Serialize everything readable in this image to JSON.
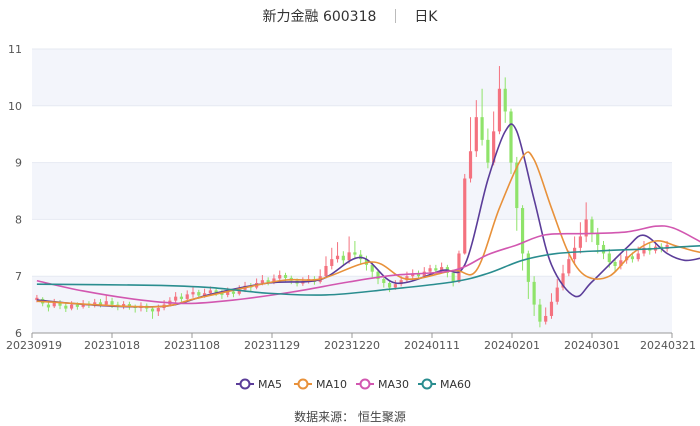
{
  "header": {
    "name": "新力金融",
    "code": "600318",
    "period": "日K"
  },
  "source": "数据来源： 恒生聚源",
  "colors": {
    "up": "#f4727f",
    "down": "#8fe36a",
    "ma5": "#5b3d99",
    "ma10": "#e8913a",
    "ma30": "#d257b0",
    "ma60": "#2a8d8f"
  },
  "chart_data": {
    "type": "candlestick",
    "title": "新力金融 600318 日K",
    "ylim": [
      6,
      11
    ],
    "yticks": [
      6,
      7,
      8,
      9,
      10,
      11
    ],
    "xticks": [
      "20230919",
      "20231018",
      "20231108",
      "20231129",
      "20231220",
      "20240111",
      "20240201",
      "20240301",
      "20240321"
    ],
    "grid": true,
    "legend_position": "bottom",
    "legend": [
      "MA5",
      "MA10",
      "MA30",
      "MA60"
    ],
    "candles": [
      [
        6.58,
        6.62,
        6.54,
        6.67
      ],
      [
        6.6,
        6.52,
        6.47,
        6.63
      ],
      [
        6.5,
        6.45,
        6.38,
        6.55
      ],
      [
        6.47,
        6.55,
        6.44,
        6.6
      ],
      [
        6.55,
        6.48,
        6.42,
        6.58
      ],
      [
        6.48,
        6.43,
        6.37,
        6.52
      ],
      [
        6.43,
        6.5,
        6.4,
        6.56
      ],
      [
        6.5,
        6.46,
        6.41,
        6.54
      ],
      [
        6.46,
        6.52,
        6.43,
        6.58
      ],
      [
        6.52,
        6.49,
        6.44,
        6.56
      ],
      [
        6.49,
        6.54,
        6.45,
        6.6
      ],
      [
        6.54,
        6.5,
        6.45,
        6.6
      ],
      [
        6.5,
        6.56,
        6.47,
        6.66
      ],
      [
        6.56,
        6.5,
        6.44,
        6.62
      ],
      [
        6.5,
        6.46,
        6.4,
        6.55
      ],
      [
        6.46,
        6.51,
        6.42,
        6.56
      ],
      [
        6.51,
        6.47,
        6.41,
        6.55
      ],
      [
        6.47,
        6.44,
        6.36,
        6.5
      ],
      [
        6.44,
        6.48,
        6.38,
        6.54
      ],
      [
        6.48,
        6.43,
        6.37,
        6.52
      ],
      [
        6.43,
        6.38,
        6.25,
        6.47
      ],
      [
        6.38,
        6.44,
        6.3,
        6.5
      ],
      [
        6.44,
        6.5,
        6.4,
        6.58
      ],
      [
        6.5,
        6.57,
        6.47,
        6.63
      ],
      [
        6.57,
        6.64,
        6.53,
        6.72
      ],
      [
        6.64,
        6.6,
        6.55,
        6.7
      ],
      [
        6.6,
        6.68,
        6.57,
        6.75
      ],
      [
        6.68,
        6.72,
        6.62,
        6.8
      ],
      [
        6.72,
        6.66,
        6.6,
        6.76
      ],
      [
        6.66,
        6.7,
        6.62,
        6.78
      ],
      [
        6.7,
        6.75,
        6.66,
        6.82
      ],
      [
        6.75,
        6.71,
        6.65,
        6.8
      ],
      [
        6.71,
        6.67,
        6.6,
        6.76
      ],
      [
        6.67,
        6.73,
        6.63,
        6.8
      ],
      [
        6.73,
        6.69,
        6.63,
        6.78
      ],
      [
        6.69,
        6.76,
        6.66,
        6.84
      ],
      [
        6.76,
        6.83,
        6.72,
        6.9
      ],
      [
        6.83,
        6.8,
        6.74,
        6.88
      ],
      [
        6.8,
        6.88,
        6.77,
        6.96
      ],
      [
        6.88,
        6.93,
        6.84,
        7.02
      ],
      [
        6.93,
        6.89,
        6.84,
        6.98
      ],
      [
        6.89,
        6.96,
        6.86,
        7.03
      ],
      [
        6.96,
        7.02,
        6.92,
        7.1
      ],
      [
        7.02,
        6.97,
        6.91,
        7.06
      ],
      [
        6.97,
        6.92,
        6.86,
        7.01
      ],
      [
        6.92,
        6.87,
        6.82,
        6.96
      ],
      [
        6.87,
        6.91,
        6.83,
        6.98
      ],
      [
        6.91,
        6.95,
        6.87,
        7.02
      ],
      [
        6.95,
        6.9,
        6.85,
        7.0
      ],
      [
        6.9,
        7.0,
        6.87,
        7.12
      ],
      [
        7.0,
        7.18,
        6.96,
        7.35
      ],
      [
        7.18,
        7.3,
        7.12,
        7.5
      ],
      [
        7.3,
        7.36,
        7.24,
        7.6
      ],
      [
        7.36,
        7.28,
        7.2,
        7.44
      ],
      [
        7.28,
        7.42,
        7.22,
        7.7
      ],
      [
        7.42,
        7.38,
        7.3,
        7.62
      ],
      [
        7.38,
        7.3,
        7.2,
        7.46
      ],
      [
        7.3,
        7.2,
        7.1,
        7.36
      ],
      [
        7.2,
        7.08,
        6.98,
        7.25
      ],
      [
        7.08,
        6.95,
        6.86,
        7.12
      ],
      [
        6.95,
        6.88,
        6.8,
        7.0
      ],
      [
        6.88,
        6.8,
        6.72,
        6.93
      ],
      [
        6.8,
        6.86,
        6.76,
        6.93
      ],
      [
        6.86,
        6.93,
        6.82,
        7.0
      ],
      [
        6.93,
        7.0,
        6.88,
        7.08
      ],
      [
        7.0,
        7.05,
        6.96,
        7.12
      ],
      [
        7.05,
        7.0,
        6.94,
        7.1
      ],
      [
        7.0,
        7.08,
        6.97,
        7.16
      ],
      [
        7.08,
        7.14,
        7.03,
        7.2
      ],
      [
        7.14,
        7.1,
        7.04,
        7.2
      ],
      [
        7.1,
        7.16,
        7.06,
        7.24
      ],
      [
        7.16,
        7.06,
        6.98,
        7.2
      ],
      [
        7.06,
        6.9,
        6.82,
        7.1
      ],
      [
        6.9,
        7.4,
        6.88,
        7.45
      ],
      [
        7.4,
        8.72,
        7.38,
        8.8
      ],
      [
        8.72,
        9.2,
        8.65,
        9.8
      ],
      [
        9.2,
        9.8,
        9.1,
        10.1
      ],
      [
        9.8,
        9.4,
        9.3,
        10.3
      ],
      [
        9.4,
        9.0,
        8.9,
        9.6
      ],
      [
        9.0,
        9.55,
        8.95,
        9.9
      ],
      [
        9.55,
        10.3,
        9.5,
        10.7
      ],
      [
        10.3,
        9.9,
        9.7,
        10.5
      ],
      [
        9.9,
        9.0,
        8.8,
        9.95
      ],
      [
        9.0,
        8.2,
        7.8,
        9.1
      ],
      [
        8.2,
        7.4,
        7.1,
        8.25
      ],
      [
        7.4,
        6.9,
        6.6,
        7.45
      ],
      [
        6.9,
        6.5,
        6.3,
        7.0
      ],
      [
        6.5,
        6.2,
        6.1,
        6.6
      ],
      [
        6.2,
        6.3,
        6.15,
        6.45
      ],
      [
        6.3,
        6.55,
        6.25,
        6.7
      ],
      [
        6.55,
        6.8,
        6.5,
        6.95
      ],
      [
        6.8,
        7.05,
        6.75,
        7.2
      ],
      [
        7.05,
        7.3,
        7.0,
        7.45
      ],
      [
        7.3,
        7.5,
        7.2,
        7.7
      ],
      [
        7.5,
        7.7,
        7.4,
        7.95
      ],
      [
        7.7,
        8.0,
        7.6,
        8.3
      ],
      [
        8.0,
        7.75,
        7.6,
        8.05
      ],
      [
        7.75,
        7.55,
        7.4,
        7.85
      ],
      [
        7.55,
        7.4,
        7.3,
        7.62
      ],
      [
        7.4,
        7.25,
        7.15,
        7.48
      ],
      [
        7.25,
        7.18,
        7.08,
        7.32
      ],
      [
        7.18,
        7.28,
        7.12,
        7.38
      ],
      [
        7.28,
        7.35,
        7.22,
        7.45
      ],
      [
        7.35,
        7.3,
        7.24,
        7.42
      ],
      [
        7.3,
        7.4,
        7.26,
        7.52
      ],
      [
        7.4,
        7.5,
        7.35,
        7.62
      ],
      [
        7.5,
        7.45,
        7.38,
        7.58
      ],
      [
        7.45,
        7.52,
        7.4,
        7.6
      ],
      [
        7.52,
        7.48,
        7.42,
        7.58
      ],
      [
        7.48,
        7.55,
        7.43,
        7.62
      ]
    ],
    "series": [
      {
        "name": "MA5",
        "values": [
          [
            0,
            6.58
          ],
          [
            10,
            6.49
          ],
          [
            19,
            6.46
          ],
          [
            24,
            6.5
          ],
          [
            30,
            6.68
          ],
          [
            40,
            6.88
          ],
          [
            49,
            6.94
          ],
          [
            56,
            7.33
          ],
          [
            62,
            6.88
          ],
          [
            70,
            7.1
          ],
          [
            74,
            7.2
          ],
          [
            78,
            8.7
          ],
          [
            81,
            9.55
          ],
          [
            83,
            9.55
          ],
          [
            86,
            8.35
          ],
          [
            89,
            7.2
          ],
          [
            93,
            6.65
          ],
          [
            96,
            6.9
          ],
          [
            102,
            7.5
          ],
          [
            105,
            7.72
          ],
          [
            109,
            7.4
          ],
          [
            112,
            7.28
          ],
          [
            115,
            7.32
          ],
          [
            120,
            7.42
          ],
          [
            124,
            7.48
          ]
        ]
      },
      {
        "name": "MA10",
        "values": [
          [
            0,
            6.56
          ],
          [
            20,
            6.46
          ],
          [
            28,
            6.62
          ],
          [
            42,
            6.92
          ],
          [
            49,
            6.95
          ],
          [
            58,
            7.25
          ],
          [
            64,
            6.95
          ],
          [
            72,
            7.1
          ],
          [
            76,
            7.1
          ],
          [
            80,
            8.2
          ],
          [
            84,
            9.1
          ],
          [
            86,
            9.05
          ],
          [
            89,
            8.2
          ],
          [
            92,
            7.4
          ],
          [
            95,
            7.0
          ],
          [
            99,
            7.0
          ],
          [
            103,
            7.4
          ],
          [
            107,
            7.62
          ],
          [
            111,
            7.52
          ],
          [
            116,
            7.4
          ],
          [
            124,
            7.4
          ]
        ]
      },
      {
        "name": "MA30",
        "values": [
          [
            0,
            6.92
          ],
          [
            8,
            6.74
          ],
          [
            18,
            6.58
          ],
          [
            26,
            6.52
          ],
          [
            34,
            6.58
          ],
          [
            44,
            6.72
          ],
          [
            54,
            6.9
          ],
          [
            62,
            7.02
          ],
          [
            72,
            7.1
          ],
          [
            78,
            7.38
          ],
          [
            83,
            7.55
          ],
          [
            88,
            7.73
          ],
          [
            95,
            7.75
          ],
          [
            102,
            7.78
          ],
          [
            107,
            7.88
          ],
          [
            110,
            7.85
          ],
          [
            114,
            7.65
          ],
          [
            118,
            7.42
          ],
          [
            122,
            7.3
          ],
          [
            124,
            7.3
          ]
        ]
      },
      {
        "name": "MA60",
        "values": [
          [
            0,
            6.86
          ],
          [
            20,
            6.84
          ],
          [
            30,
            6.8
          ],
          [
            40,
            6.7
          ],
          [
            50,
            6.67
          ],
          [
            60,
            6.76
          ],
          [
            72,
            6.9
          ],
          [
            78,
            7.05
          ],
          [
            84,
            7.28
          ],
          [
            90,
            7.4
          ],
          [
            98,
            7.45
          ],
          [
            106,
            7.48
          ],
          [
            112,
            7.52
          ],
          [
            118,
            7.55
          ],
          [
            124,
            7.55
          ]
        ]
      }
    ]
  }
}
